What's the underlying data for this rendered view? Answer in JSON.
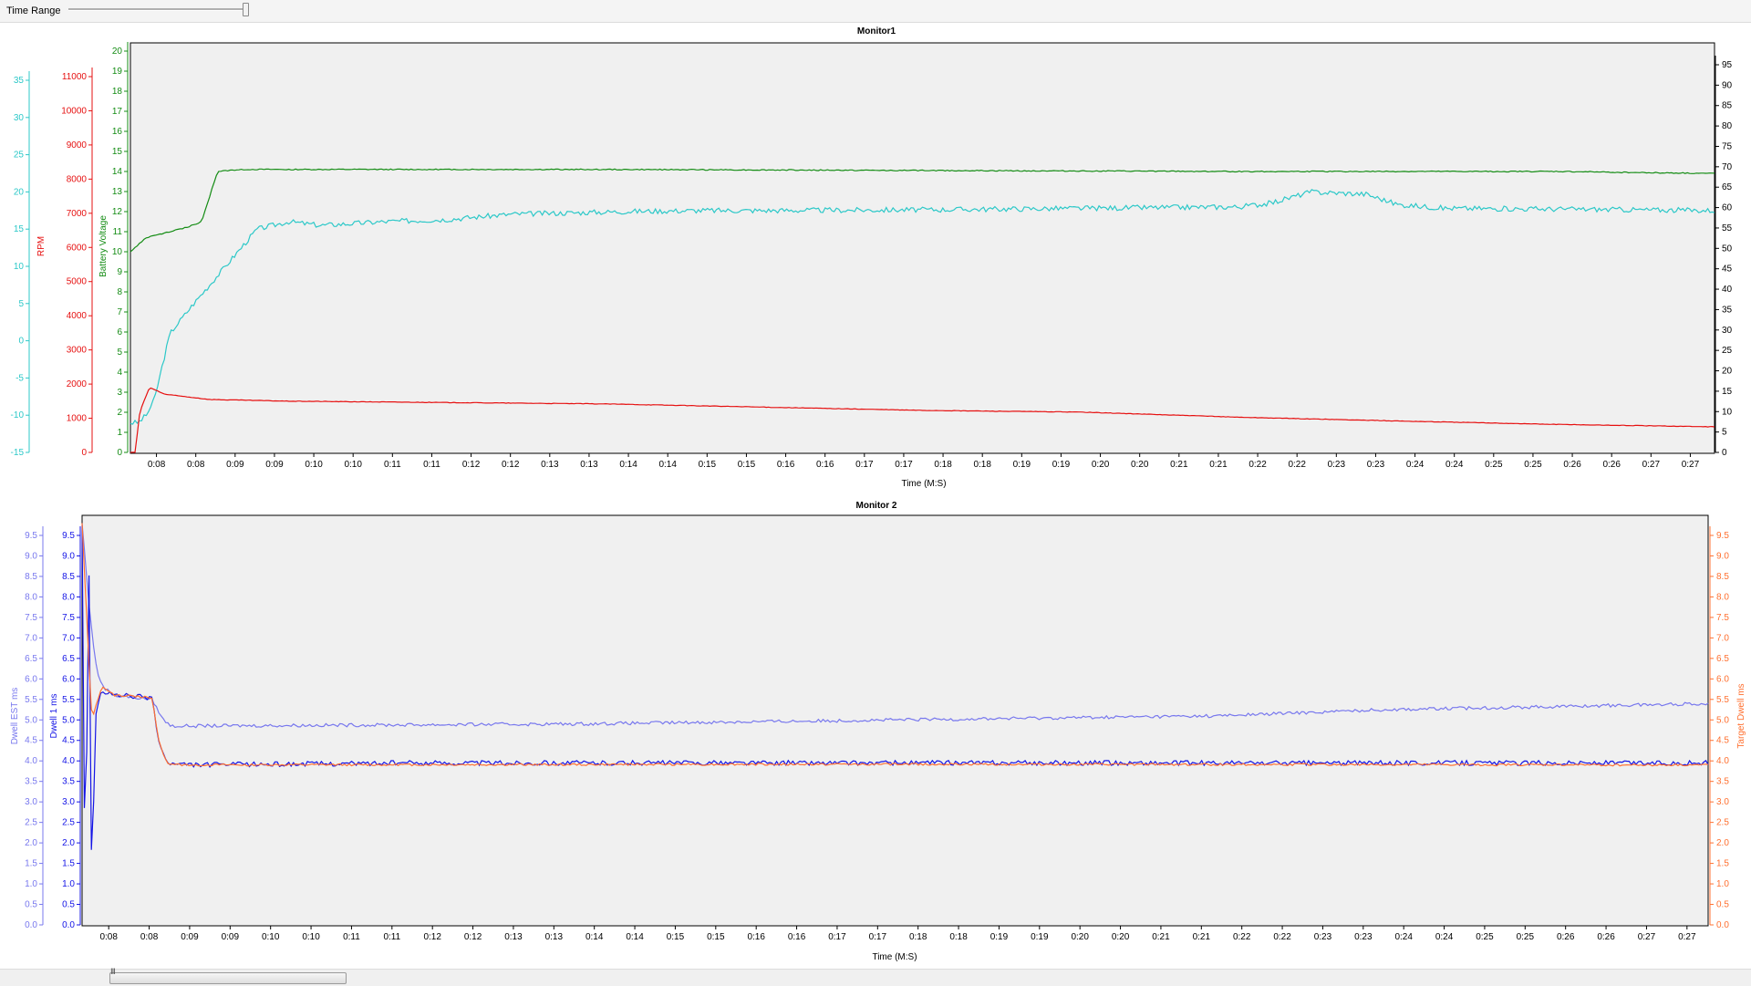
{
  "toolbar": {
    "time_range_label": "Time Range",
    "time_range_value": 1.0
  },
  "scrollbar": {
    "grip": "III",
    "position": 0.06,
    "size": 0.13
  },
  "colors": {
    "cyan": "#2cc8c8",
    "red": "#e61010",
    "green": "#148c14",
    "blue": "#1414e6",
    "lightblue": "#7878ee",
    "orange": "#ff7030",
    "plot_bg": "#f0f0f0"
  },
  "monitor1": {
    "title": "Monitor1",
    "xlabel": "Time (M:S)",
    "x_ticks": [
      "0:08",
      "0:08",
      "0:09",
      "0:09",
      "0:10",
      "0:10",
      "0:11",
      "0:11",
      "0:12",
      "0:12",
      "0:13",
      "0:13",
      "0:14",
      "0:14",
      "0:15",
      "0:15",
      "0:16",
      "0:16",
      "0:17",
      "0:17",
      "0:18",
      "0:18",
      "0:19",
      "0:19",
      "0:20",
      "0:20",
      "0:21",
      "0:21",
      "0:22",
      "0:22",
      "0:23",
      "0:23",
      "0:24",
      "0:24",
      "0:25",
      "0:25",
      "0:26",
      "0:26",
      "0:27",
      "0:27"
    ],
    "axis_cyan": {
      "label": "",
      "ticks": [
        "-15",
        "-10",
        "-5",
        "0",
        "5",
        "10",
        "15",
        "20",
        "25",
        "30",
        "35"
      ],
      "min": -15,
      "max": 35
    },
    "axis_rpm": {
      "label": "RPM",
      "ticks": [
        "0",
        "1000",
        "2000",
        "3000",
        "4000",
        "5000",
        "6000",
        "7000",
        "8000",
        "9000",
        "10000",
        "11000"
      ],
      "min": 0,
      "max": 11000
    },
    "axis_voltage": {
      "label": "Battery Voltage",
      "ticks": [
        "0",
        "1",
        "2",
        "3",
        "4",
        "5",
        "6",
        "7",
        "8",
        "9",
        "10",
        "11",
        "12",
        "13",
        "14",
        "15",
        "16",
        "17",
        "18",
        "19",
        "20"
      ],
      "min": 0,
      "max": 20
    },
    "axis_right": {
      "label": "",
      "ticks": [
        "0",
        "5",
        "10",
        "15",
        "20",
        "25",
        "30",
        "35",
        "40",
        "45",
        "50",
        "55",
        "60",
        "65",
        "70",
        "75",
        "80",
        "85",
        "90",
        "95"
      ],
      "min": 0,
      "max": 95
    }
  },
  "monitor2": {
    "title": "Monitor 2",
    "xlabel": "Time (M:S)",
    "x_ticks": [
      "0:08",
      "0:08",
      "0:09",
      "0:09",
      "0:10",
      "0:10",
      "0:11",
      "0:11",
      "0:12",
      "0:12",
      "0:13",
      "0:13",
      "0:14",
      "0:14",
      "0:15",
      "0:15",
      "0:16",
      "0:16",
      "0:17",
      "0:17",
      "0:18",
      "0:18",
      "0:19",
      "0:19",
      "0:20",
      "0:20",
      "0:21",
      "0:21",
      "0:22",
      "0:22",
      "0:23",
      "0:23",
      "0:24",
      "0:24",
      "0:25",
      "0:25",
      "0:26",
      "0:26",
      "0:27",
      "0:27"
    ],
    "axis_est": {
      "label": "Dwell EST ms",
      "ticks": [
        "0.0",
        "0.5",
        "1.0",
        "1.5",
        "2.0",
        "2.5",
        "3.0",
        "3.5",
        "4.0",
        "4.5",
        "5.0",
        "5.5",
        "6.0",
        "6.5",
        "7.0",
        "7.5",
        "8.0",
        "8.5",
        "9.0",
        "9.5"
      ],
      "min": 0,
      "max": 9.5
    },
    "axis_dwell1": {
      "label": "Dwell 1 ms",
      "ticks": [
        "0.0",
        "0.5",
        "1.0",
        "1.5",
        "2.0",
        "2.5",
        "3.0",
        "3.5",
        "4.0",
        "4.5",
        "5.0",
        "5.5",
        "6.0",
        "6.5",
        "7.0",
        "7.5",
        "8.0",
        "8.5",
        "9.0",
        "9.5"
      ],
      "min": 0,
      "max": 9.5
    },
    "axis_target": {
      "label": "Target Dwell ms",
      "ticks": [
        "0.0",
        "0.5",
        "1.0",
        "1.5",
        "2.0",
        "2.5",
        "3.0",
        "3.5",
        "4.0",
        "4.5",
        "5.0",
        "5.5",
        "6.0",
        "6.5",
        "7.0",
        "7.5",
        "8.0",
        "8.5",
        "9.0",
        "9.5"
      ],
      "min": 0,
      "max": 9.5
    }
  },
  "chart_data": [
    {
      "type": "line",
      "title": "Monitor1",
      "xlabel": "Time (M:S)",
      "series": [
        {
          "name": "",
          "axis": "cyan",
          "color": "#2cc8c8",
          "points": [
            [
              0,
              -11
            ],
            [
              0.005,
              -11
            ],
            [
              0.01,
              -10
            ],
            [
              0.015,
              -8
            ],
            [
              0.025,
              1
            ],
            [
              0.04,
              5
            ],
            [
              0.06,
              10
            ],
            [
              0.08,
              15
            ],
            [
              0.1,
              16
            ],
            [
              0.12,
              15.5
            ],
            [
              0.16,
              16
            ],
            [
              0.2,
              16.3
            ],
            [
              0.24,
              17
            ],
            [
              0.28,
              17.2
            ],
            [
              0.32,
              17.4
            ],
            [
              0.36,
              17.5
            ],
            [
              0.4,
              17.5
            ],
            [
              0.5,
              17.6
            ],
            [
              0.6,
              17.8
            ],
            [
              0.7,
              18
            ],
            [
              0.72,
              18.5
            ],
            [
              0.745,
              20
            ],
            [
              0.78,
              19.7
            ],
            [
              0.8,
              18.3
            ],
            [
              0.83,
              17.8
            ],
            [
              0.9,
              17.7
            ],
            [
              0.95,
              17.6
            ],
            [
              1,
              17.5
            ]
          ]
        },
        {
          "name": "RPM",
          "axis": "rpm",
          "color": "#e61010",
          "points": [
            [
              0,
              0
            ],
            [
              0.003,
              0
            ],
            [
              0.006,
              1200
            ],
            [
              0.012,
              1900
            ],
            [
              0.022,
              1700
            ],
            [
              0.05,
              1550
            ],
            [
              0.1,
              1500
            ],
            [
              0.3,
              1420
            ],
            [
              0.5,
              1230
            ],
            [
              0.6,
              1180
            ],
            [
              0.7,
              1030
            ],
            [
              0.8,
              920
            ],
            [
              0.9,
              820
            ],
            [
              1,
              750
            ]
          ]
        },
        {
          "name": "Battery Voltage",
          "axis": "voltage",
          "color": "#148c14",
          "points": [
            [
              0,
              10
            ],
            [
              0.01,
              10.7
            ],
            [
              0.035,
              11.2
            ],
            [
              0.045,
              11.5
            ],
            [
              0.055,
              14
            ],
            [
              0.07,
              14.1
            ],
            [
              0.3,
              14.1
            ],
            [
              0.5,
              14.05
            ],
            [
              0.7,
              14
            ],
            [
              0.9,
              14
            ],
            [
              1,
              13.9
            ]
          ]
        }
      ]
    },
    {
      "type": "line",
      "title": "Monitor 2",
      "xlabel": "Time (M:S)",
      "series": [
        {
          "name": "Dwell EST ms",
          "axis": "est",
          "color": "#7878ee",
          "points": [
            [
              0,
              9.8
            ],
            [
              0.005,
              7.5
            ],
            [
              0.009,
              6.2
            ],
            [
              0.013,
              5.8
            ],
            [
              0.02,
              5.6
            ],
            [
              0.043,
              5.5
            ],
            [
              0.05,
              5.0
            ],
            [
              0.055,
              4.85
            ],
            [
              0.3,
              4.9
            ],
            [
              0.5,
              5.0
            ],
            [
              0.7,
              5.1
            ],
            [
              0.8,
              5.25
            ],
            [
              0.9,
              5.32
            ],
            [
              1,
              5.4
            ]
          ]
        },
        {
          "name": "Dwell 1 ms",
          "axis": "dwell1",
          "color": "#1414e6",
          "points": [
            [
              0,
              9.8
            ],
            [
              0.002,
              0.1
            ],
            [
              0.004,
              9.8
            ],
            [
              0.006,
              0.5
            ],
            [
              0.008,
              5.0
            ],
            [
              0.012,
              5.7
            ],
            [
              0.02,
              5.6
            ],
            [
              0.043,
              5.55
            ],
            [
              0.047,
              4.5
            ],
            [
              0.052,
              3.95
            ],
            [
              0.06,
              3.9
            ],
            [
              0.2,
              3.95
            ],
            [
              0.5,
              3.95
            ],
            [
              0.8,
              3.95
            ],
            [
              1,
              3.95
            ]
          ]
        },
        {
          "name": "Target Dwell ms",
          "axis": "target",
          "color": "#ff7030",
          "points": [
            [
              0,
              9.8
            ],
            [
              0.006,
              5.0
            ],
            [
              0.012,
              5.8
            ],
            [
              0.02,
              5.6
            ],
            [
              0.043,
              5.55
            ],
            [
              0.047,
              4.5
            ],
            [
              0.052,
              3.95
            ],
            [
              0.06,
              3.9
            ],
            [
              0.5,
              3.92
            ],
            [
              1,
              3.9
            ]
          ]
        }
      ]
    }
  ]
}
